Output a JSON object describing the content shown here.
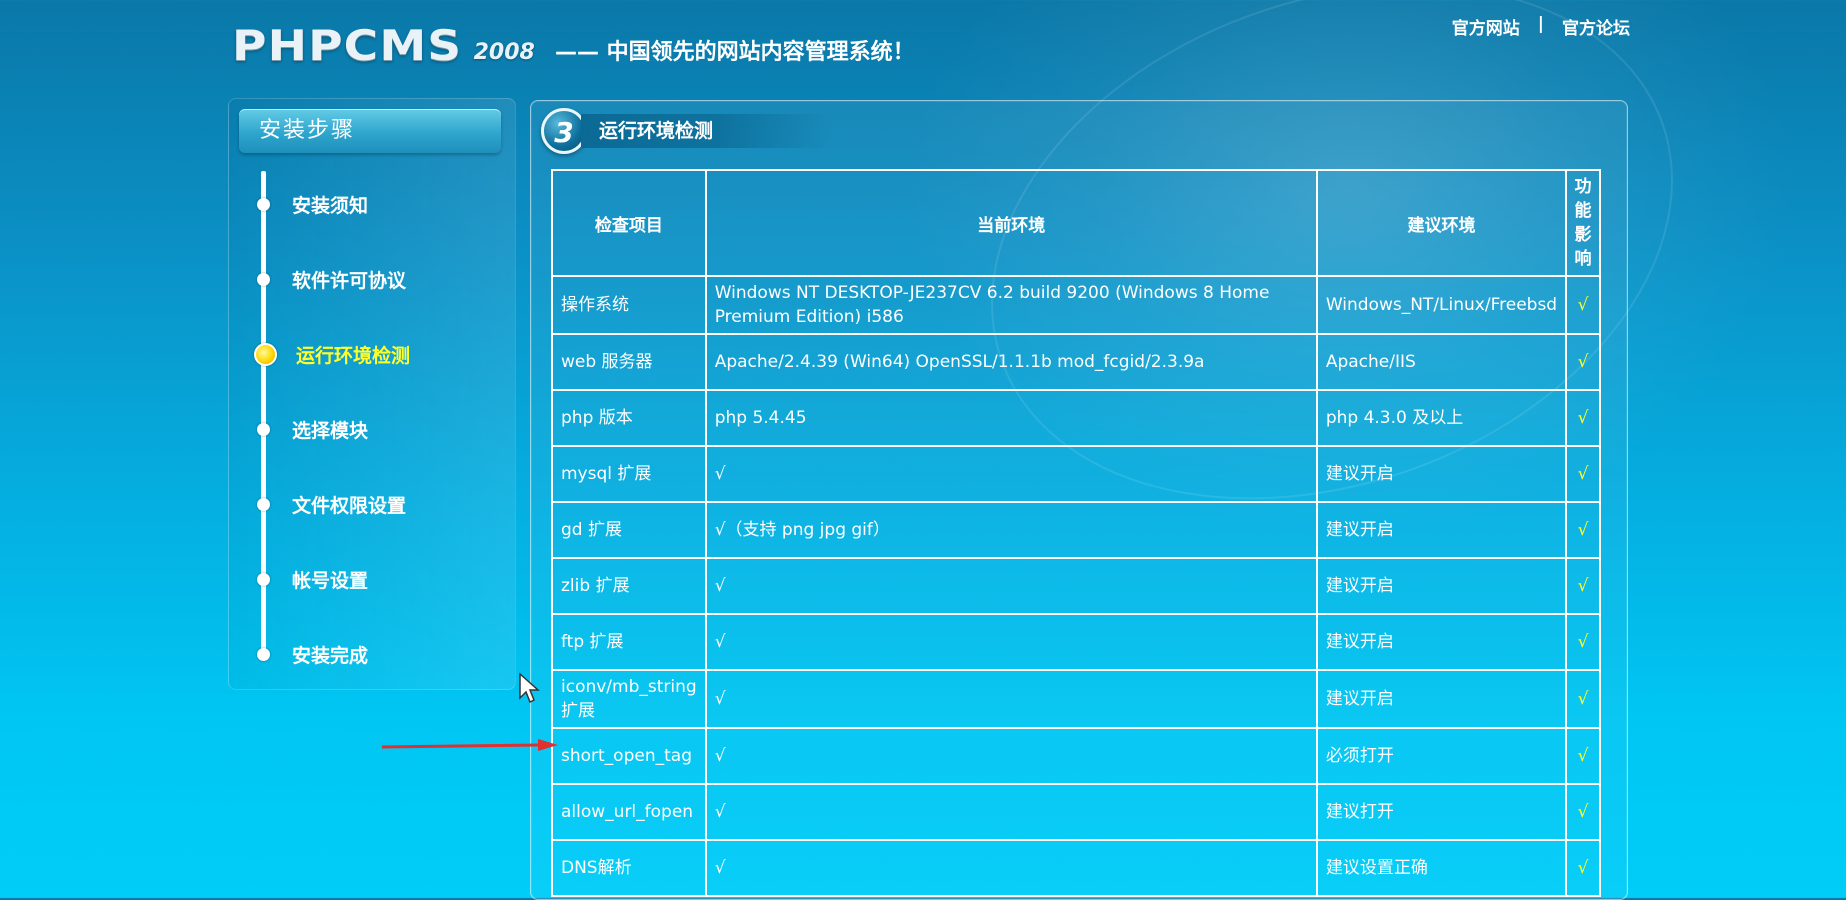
{
  "header": {
    "logo_main": "PHPCMS",
    "logo_year": "2008",
    "tagline": "—— 中国领先的网站内容管理系统！",
    "links": [
      {
        "label": "官方网站"
      },
      {
        "separator": "|"
      },
      {
        "label": "官方论坛"
      }
    ]
  },
  "sidebar": {
    "title": "安装步骤",
    "steps": [
      {
        "label": "安装须知"
      },
      {
        "label": "软件许可协议"
      },
      {
        "label": "运行环境检测"
      },
      {
        "label": "选择模块"
      },
      {
        "label": "文件权限设置"
      },
      {
        "label": "帐号设置"
      },
      {
        "label": "安装完成"
      }
    ],
    "active_index": 2
  },
  "main": {
    "step_number": "3",
    "step_title": "运行环境检测",
    "table": {
      "headers": [
        "检查项目",
        "当前环境",
        "建议环境",
        "功能影响"
      ],
      "rows": [
        {
          "item": "操作系统",
          "current": "Windows NT DESKTOP-JE237CV 6.2 build 9200 (Windows 8 Home Premium Edition) i586",
          "recommended": "Windows_NT/Linux/Freebsd",
          "effect": "√"
        },
        {
          "item": "web 服务器",
          "current": "Apache/2.4.39 (Win64) OpenSSL/1.1.1b mod_fcgid/2.3.9a",
          "recommended": "Apache/IIS",
          "effect": "√"
        },
        {
          "item": "php 版本",
          "current": "php 5.4.45",
          "recommended": "php 4.3.0 及以上",
          "effect": "√"
        },
        {
          "item": "mysql 扩展",
          "current": "√",
          "recommended": "建议开启",
          "effect": "√"
        },
        {
          "item": "gd 扩展",
          "current": "√（支持 png jpg gif）",
          "recommended": "建议开启",
          "effect": "√"
        },
        {
          "item": "zlib 扩展",
          "current": "√",
          "recommended": "建议开启",
          "effect": "√"
        },
        {
          "item": "ftp 扩展",
          "current": "√",
          "recommended": "建议开启",
          "effect": "√"
        },
        {
          "item": "iconv/mb_string 扩展",
          "current": "√",
          "recommended": "建议开启",
          "effect": "√"
        },
        {
          "item": "short_open_tag",
          "current": "√",
          "recommended": "必须打开",
          "effect": "√"
        },
        {
          "item": "allow_url_fopen",
          "current": "√",
          "recommended": "建议打开",
          "effect": "√"
        },
        {
          "item": "DNS解析",
          "current": "√",
          "recommended": "建议设置正确",
          "effect": "√"
        }
      ]
    }
  },
  "colors": {
    "background_top": "#0a78a8",
    "background_bottom": "#00cdf8",
    "active_step": "#ffff2e",
    "effect_check": "#ffff2e",
    "annotation_arrow": "#e03030"
  },
  "icons": {
    "annotation": "red-arrow-icon",
    "pointer": "mouse-cursor-icon"
  }
}
